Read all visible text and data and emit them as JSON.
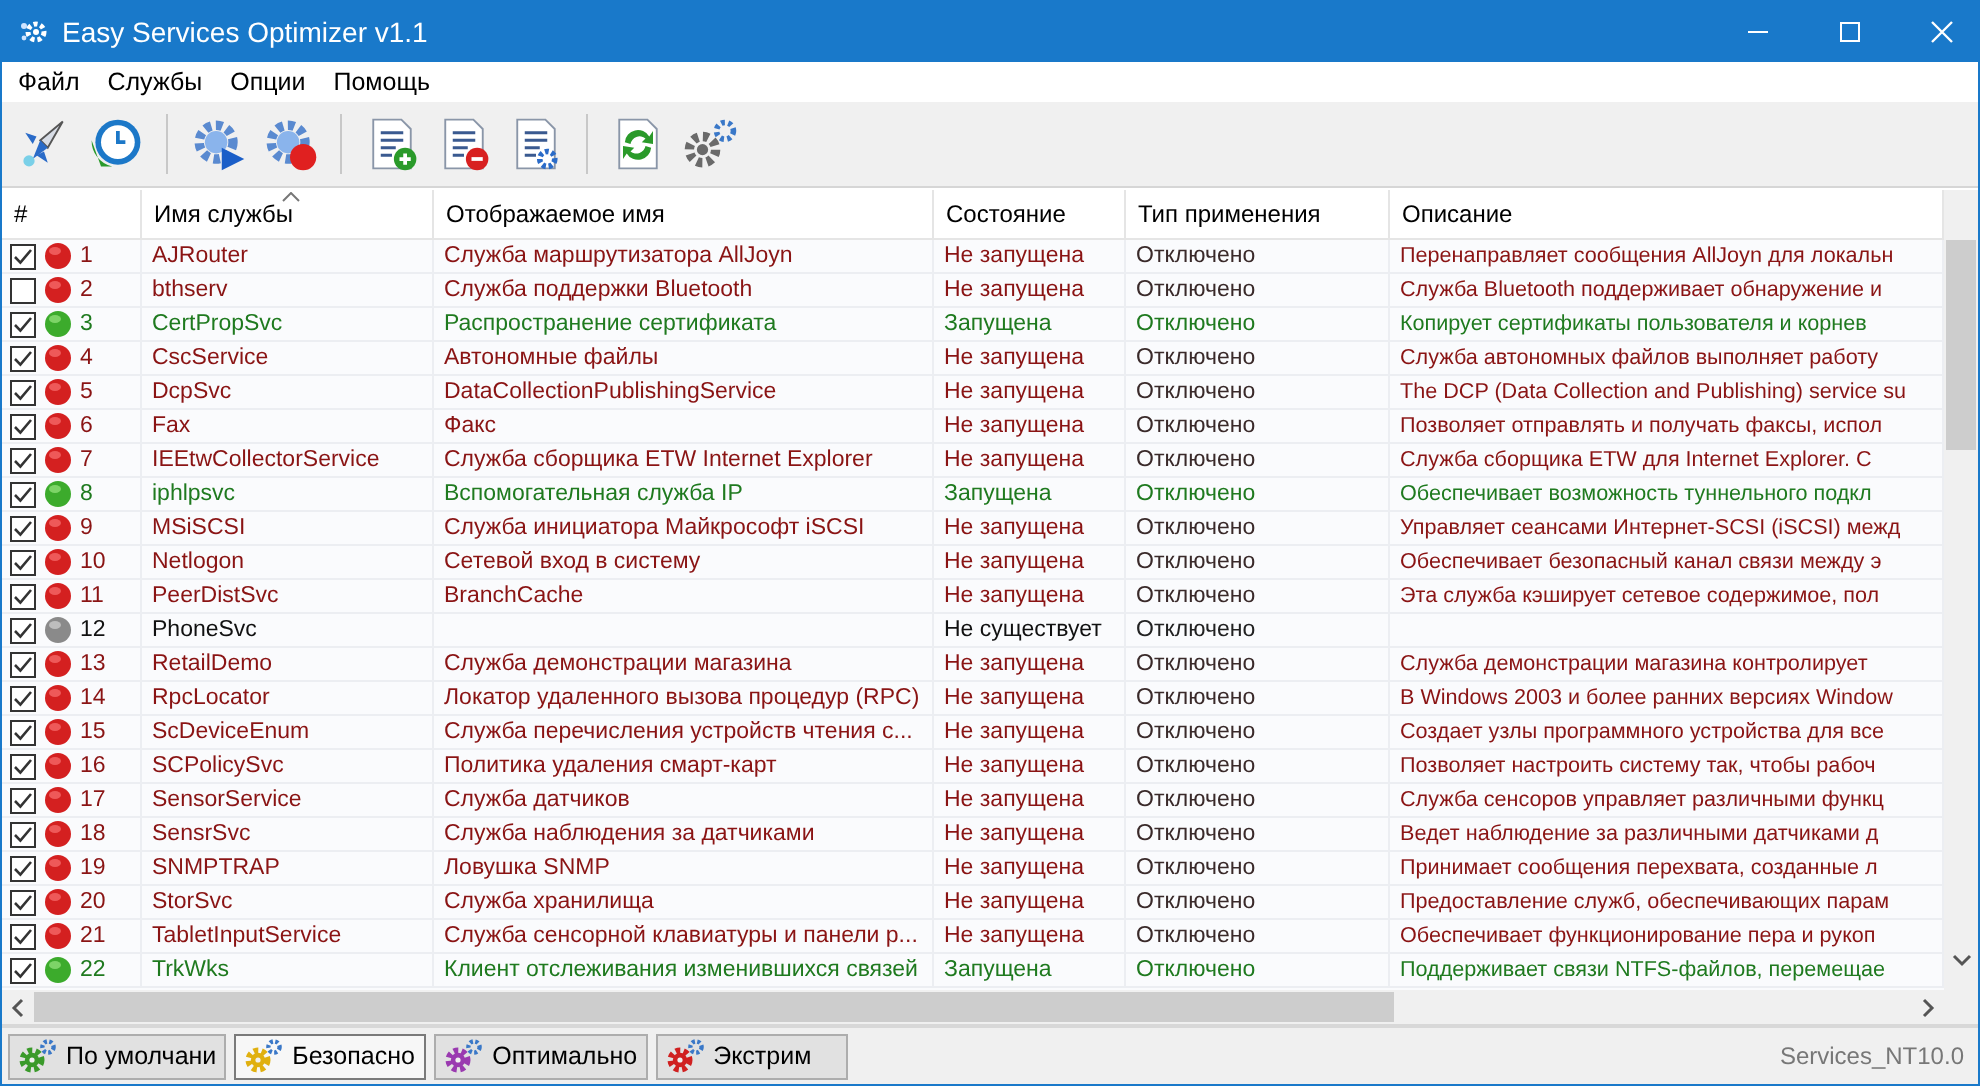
{
  "window": {
    "title": "Easy Services Optimizer v1.1"
  },
  "menu": [
    "Файл",
    "Службы",
    "Опции",
    "Помощь"
  ],
  "table": {
    "columns": [
      "#",
      "Имя службы",
      "Отображаемое имя",
      "Состояние",
      "Тип применения",
      "Описание"
    ],
    "rows": [
      {
        "checked": true,
        "kind": "stopped",
        "number": "1",
        "name": "AJRouter",
        "display": "Служба маршрутизатора AllJoyn",
        "state": "Не запущена",
        "type": "Отключено",
        "description": "Перенаправляет сообщения AllJoyn для локальн"
      },
      {
        "checked": false,
        "kind": "stopped",
        "number": "2",
        "name": "bthserv",
        "display": "Служба поддержки Bluetooth",
        "state": "Не запущена",
        "type": "Отключено",
        "description": "Служба Bluetooth поддерживает обнаружение и"
      },
      {
        "checked": true,
        "kind": "running",
        "number": "3",
        "name": "CertPropSvc",
        "display": "Распространение сертификата",
        "state": "Запущена",
        "type": "Отключено",
        "description": "Копирует сертификаты пользователя и корнев"
      },
      {
        "checked": true,
        "kind": "stopped",
        "number": "4",
        "name": "CscService",
        "display": "Автономные файлы",
        "state": "Не запущена",
        "type": "Отключено",
        "description": "Служба автономных файлов выполняет работу"
      },
      {
        "checked": true,
        "kind": "stopped",
        "number": "5",
        "name": "DcpSvc",
        "display": "DataCollectionPublishingService",
        "state": "Не запущена",
        "type": "Отключено",
        "description": "The DCP (Data Collection and Publishing) service su"
      },
      {
        "checked": true,
        "kind": "stopped",
        "number": "6",
        "name": "Fax",
        "display": "Факс",
        "state": "Не запущена",
        "type": "Отключено",
        "description": "Позволяет отправлять и получать факсы, испол"
      },
      {
        "checked": true,
        "kind": "stopped",
        "number": "7",
        "name": "IEEtwCollectorService",
        "display": "Служба сборщика ETW Internet Explorer",
        "state": "Не запущена",
        "type": "Отключено",
        "description": "Служба сборщика ETW для Internet Explorer. С"
      },
      {
        "checked": true,
        "kind": "running",
        "number": "8",
        "name": "iphlpsvc",
        "display": "Вспомогательная служба IP",
        "state": "Запущена",
        "type": "Отключено",
        "description": "Обеспечивает возможность туннельного подкл"
      },
      {
        "checked": true,
        "kind": "stopped",
        "number": "9",
        "name": "MSiSCSI",
        "display": "Служба инициатора Майкрософт iSCSI",
        "state": "Не запущена",
        "type": "Отключено",
        "description": "Управляет сеансами Интернет-SCSI (iSCSI) межд"
      },
      {
        "checked": true,
        "kind": "stopped",
        "number": "10",
        "name": "Netlogon",
        "display": "Сетевой вход в систему",
        "state": "Не запущена",
        "type": "Отключено",
        "description": "Обеспечивает безопасный канал связи между э"
      },
      {
        "checked": true,
        "kind": "stopped",
        "number": "11",
        "name": "PeerDistSvc",
        "display": "BranchCache",
        "state": "Не запущена",
        "type": "Отключено",
        "description": "Эта служба кэширует сетевое содержимое, пол"
      },
      {
        "checked": true,
        "kind": "missing",
        "number": "12",
        "name": "PhoneSvc",
        "state": "Не существует",
        "type": "Отключено"
      },
      {
        "checked": true,
        "kind": "stopped",
        "number": "13",
        "name": "RetailDemo",
        "display": "Служба демонстрации магазина",
        "state": "Не запущена",
        "type": "Отключено",
        "description": "Служба демонстрации магазина контролирует"
      },
      {
        "checked": true,
        "kind": "stopped",
        "number": "14",
        "name": "RpcLocator",
        "display": "Локатор удаленного вызова процедур (RPC)",
        "state": "Не запущена",
        "type": "Отключено",
        "description": "В Windows 2003 и более ранних версиях Window"
      },
      {
        "checked": true,
        "kind": "stopped",
        "number": "15",
        "name": "ScDeviceEnum",
        "display": "Служба перечисления устройств чтения с...",
        "state": "Не запущена",
        "type": "Отключено",
        "description": "Создает узлы программного устройства для все"
      },
      {
        "checked": true,
        "kind": "stopped",
        "number": "16",
        "name": "SCPolicySvc",
        "display": "Политика удаления смарт-карт",
        "state": "Не запущена",
        "type": "Отключено",
        "description": "Позволяет настроить систему так, чтобы рабоч"
      },
      {
        "checked": true,
        "kind": "stopped",
        "number": "17",
        "name": "SensorService",
        "display": "Служба датчиков",
        "state": "Не запущена",
        "type": "Отключено",
        "description": "Служба сенсоров управляет различными функц"
      },
      {
        "checked": true,
        "kind": "stopped",
        "number": "18",
        "name": "SensrSvc",
        "display": "Служба наблюдения за датчиками",
        "state": "Не запущена",
        "type": "Отключено",
        "description": "Ведет наблюдение за различными датчиками д"
      },
      {
        "checked": true,
        "kind": "stopped",
        "number": "19",
        "name": "SNMPTRAP",
        "display": "Ловушка SNMP",
        "state": "Не запущена",
        "type": "Отключено",
        "description": "Принимает сообщения перехвата, созданные л"
      },
      {
        "checked": true,
        "kind": "stopped",
        "number": "20",
        "name": "StorSvc",
        "display": "Служба хранилища",
        "state": "Не запущена",
        "type": "Отключено",
        "description": "Предоставление служб, обеспечивающих парам"
      },
      {
        "checked": true,
        "kind": "stopped",
        "number": "21",
        "name": "TabletInputService",
        "display": "Служба сенсорной клавиатуры и панели р...",
        "state": "Не запущена",
        "type": "Отключено",
        "description": "Обеспечивает функционирование пера и рукоп"
      },
      {
        "checked": true,
        "kind": "running",
        "number": "22",
        "name": "TrkWks",
        "display": "Клиент отслеживания изменившихся связей",
        "state": "Запущена",
        "type": "Отключено",
        "description": "Поддерживает связи NTFS-файлов, перемещае"
      }
    ]
  },
  "profiles": [
    {
      "label": "По умолчани",
      "selected": false,
      "color": "#3a9a2a"
    },
    {
      "label": "Безопасно",
      "selected": true,
      "color": "#e0b010"
    },
    {
      "label": "Оптимально",
      "selected": false,
      "color": "#9a3ab0"
    },
    {
      "label": "Экстрим",
      "selected": false,
      "color": "#d02020"
    }
  ],
  "status_bar": {
    "text": "Services_NT10.0"
  }
}
